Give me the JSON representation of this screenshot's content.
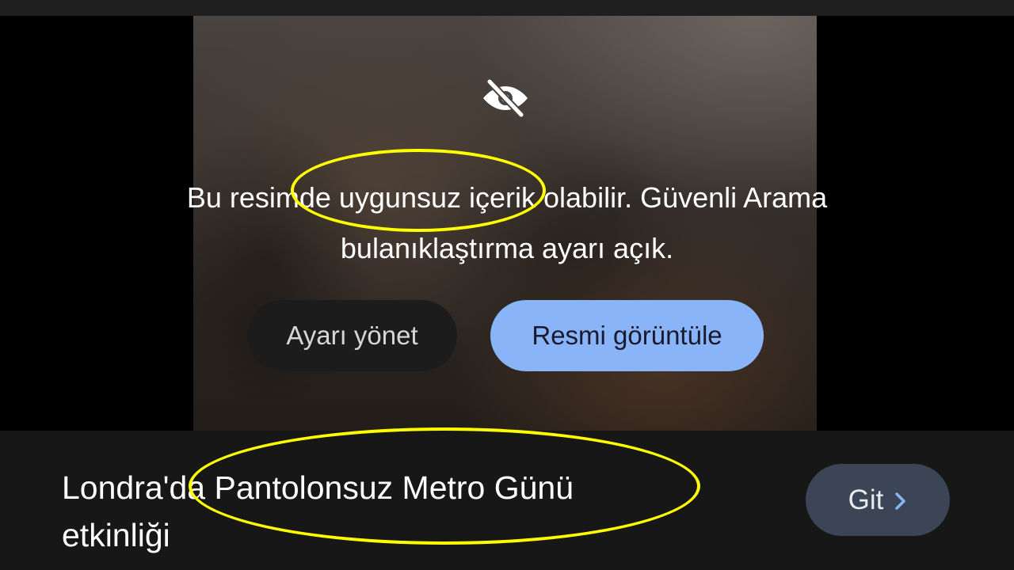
{
  "overlay": {
    "icon": "eye-off-icon",
    "warning_line1": "Bu resimde uygunsuz içerik olabilir. Güvenli Arama",
    "warning_line2": "bulanıklaştırma ayarı açık.",
    "manage_button_label": "Ayarı yönet",
    "view_button_label": "Resmi görüntüle",
    "view_button_color": "#8ab4f8"
  },
  "bottom_bar": {
    "caption_line1": "Londra'da Pantolonsuz Metro Günü",
    "caption_line2": "etkinliği",
    "go_button_label": "Git",
    "go_button_icon": "chevron-right-icon",
    "go_button_color": "#3c4555"
  },
  "annotations": {
    "highlight_color": "#ffff00"
  }
}
